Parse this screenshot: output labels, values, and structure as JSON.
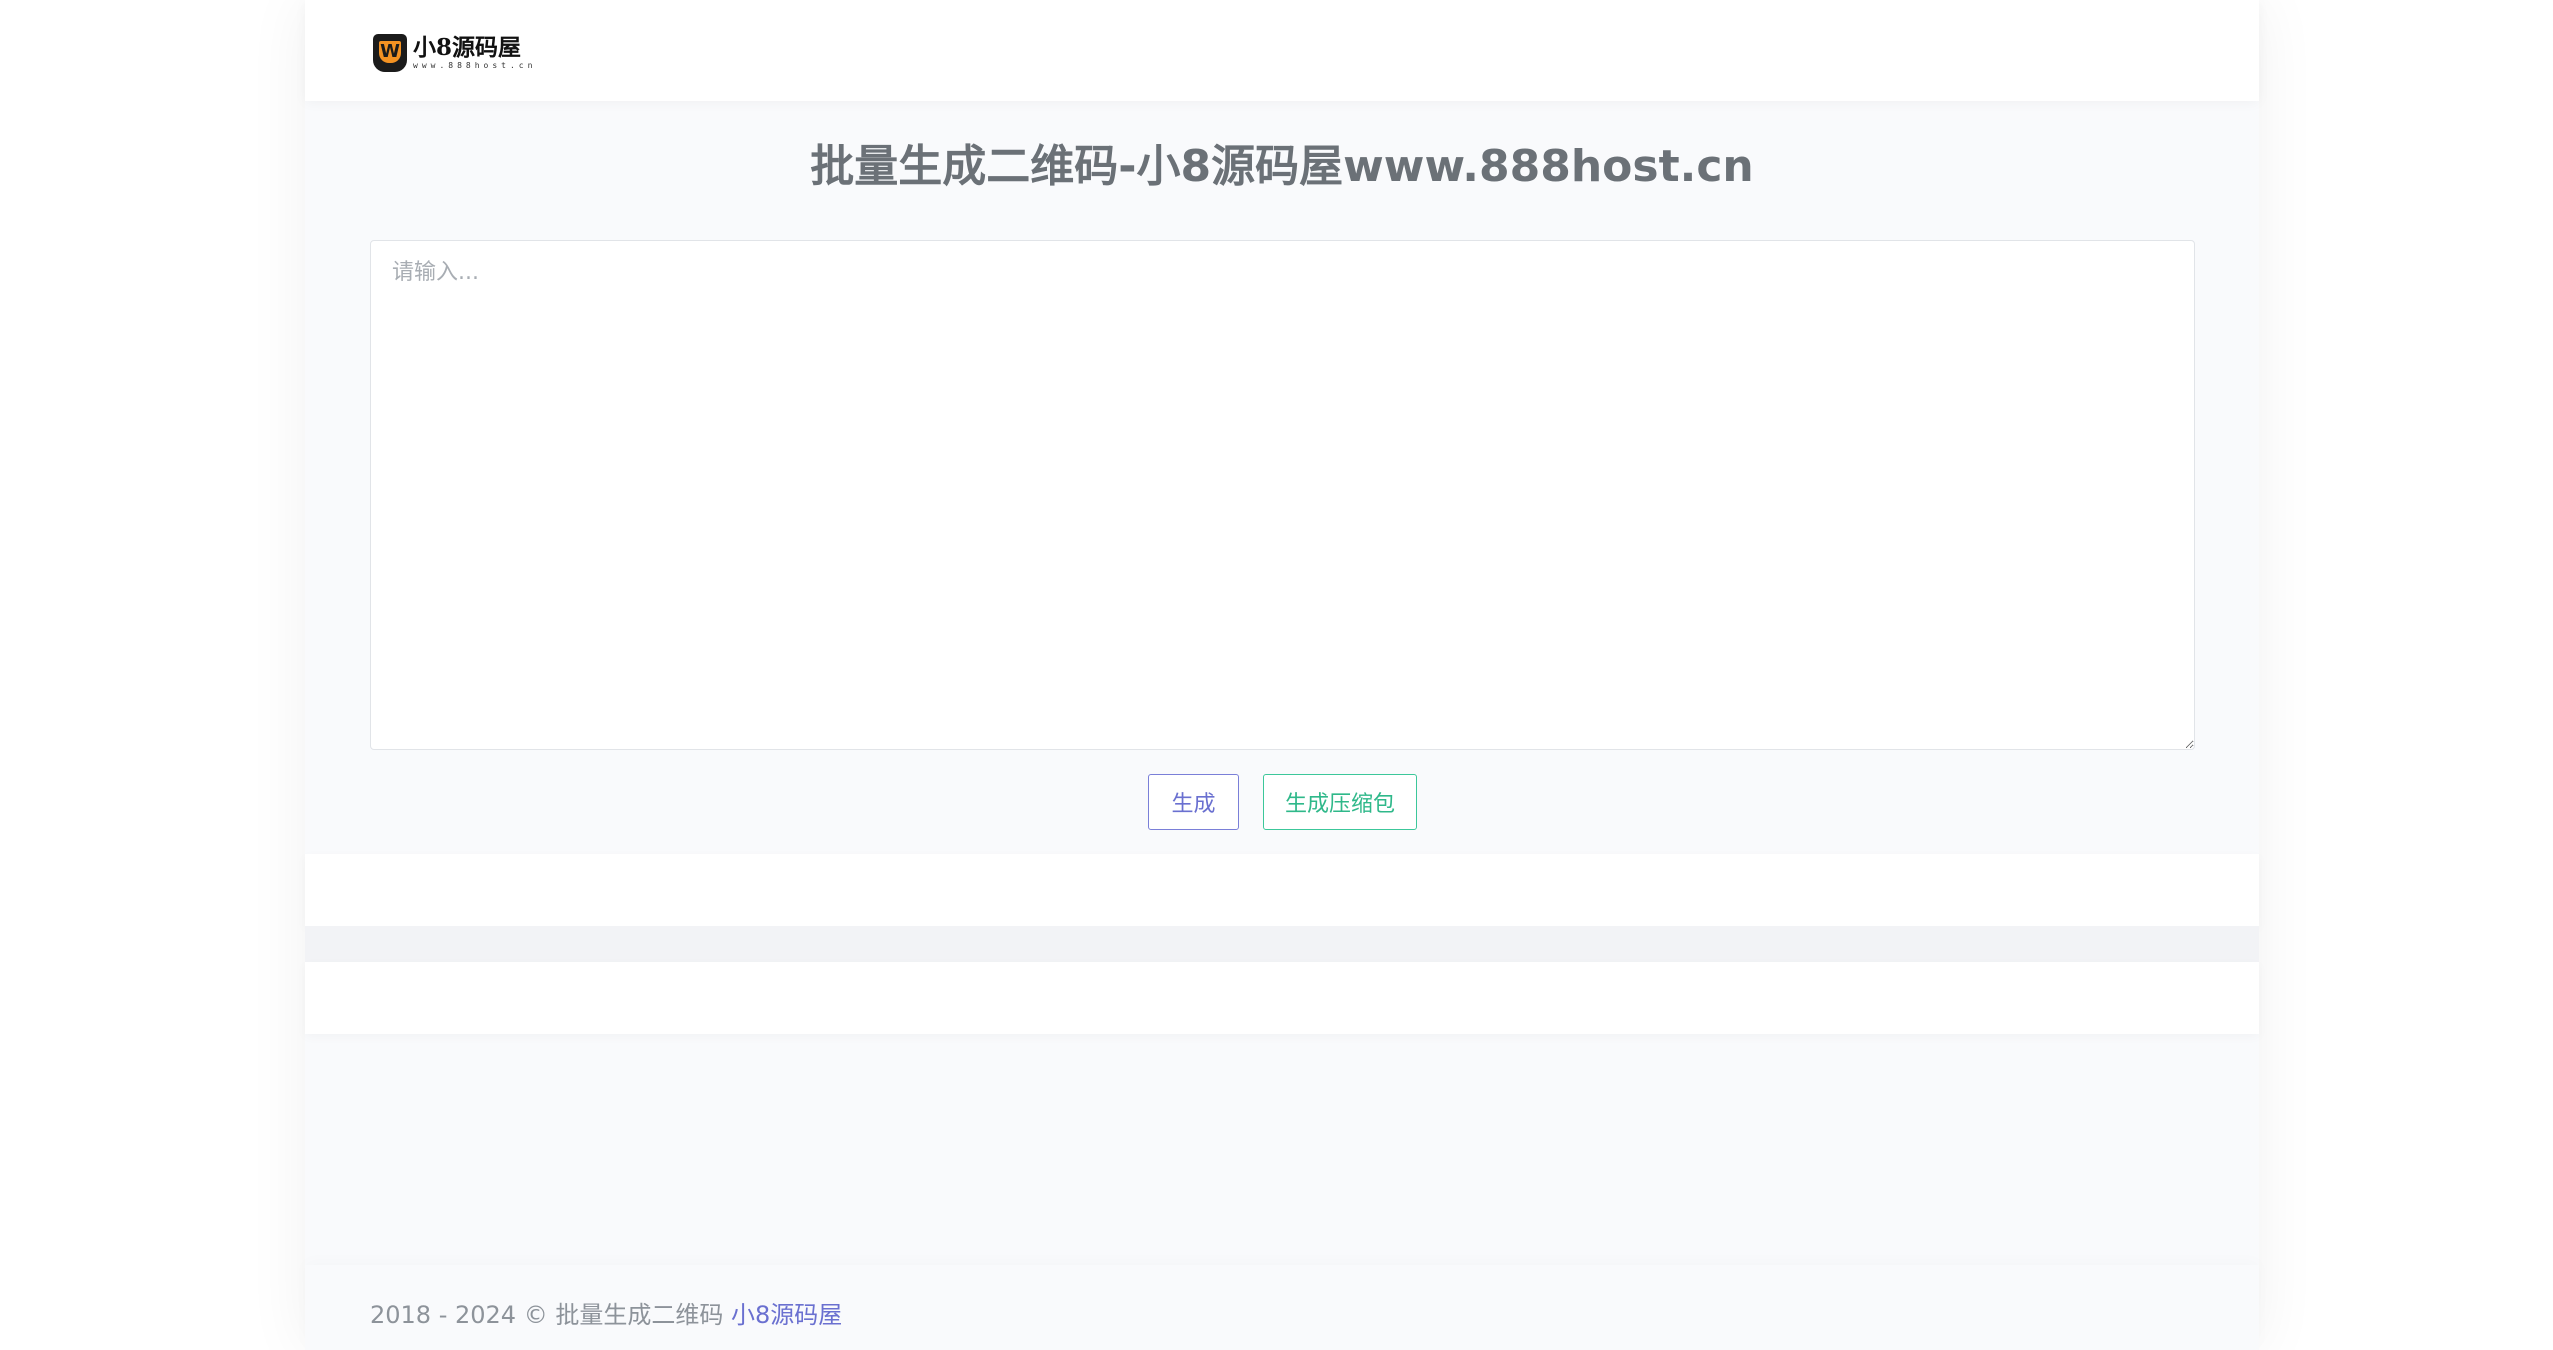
{
  "header": {
    "logo_mark": "W",
    "logo_name": "小8源码屋",
    "logo_url": "www.888host.cn"
  },
  "main": {
    "title": "批量生成二维码-小8源码屋www.888host.cn",
    "textarea_placeholder": "请输入...",
    "buttons": {
      "generate_label": "生成",
      "zip_label": "生成压缩包"
    }
  },
  "footer": {
    "copyright": "2018 - 2024 © 批量生成二维码",
    "site_link": "小8源码屋"
  },
  "colors": {
    "primary": "#6a70d0",
    "success": "#2fb88a",
    "title": "#6b7177",
    "logo_orange": "#f39222"
  }
}
